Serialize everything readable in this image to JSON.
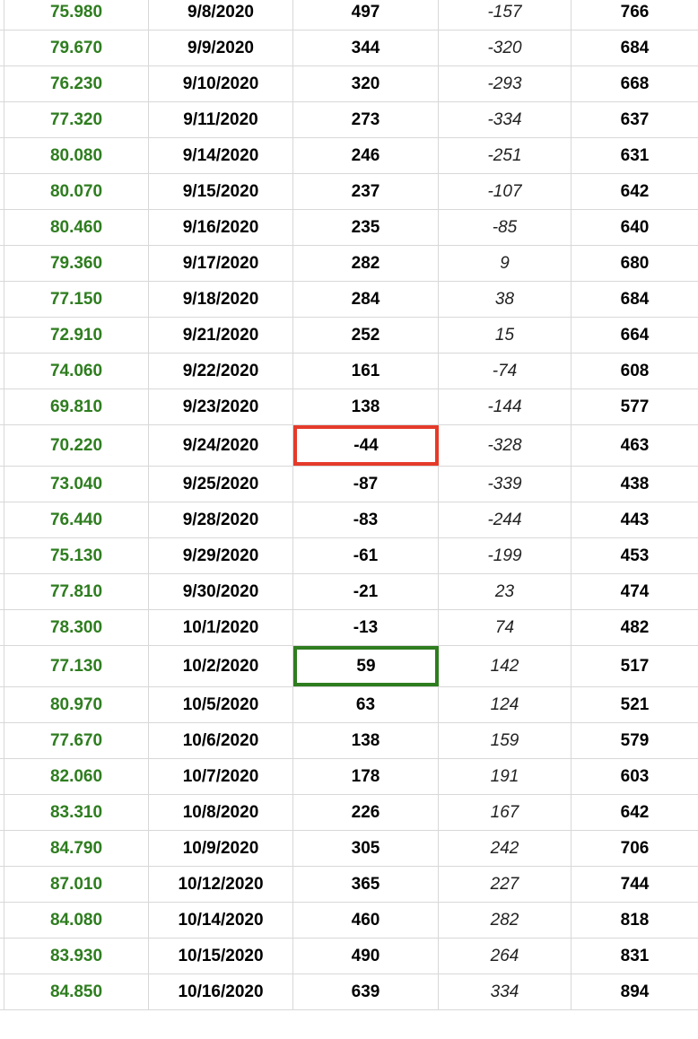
{
  "highlight_colors": {
    "red": "#e53a2a",
    "green": "#2e7d1f"
  },
  "rows": [
    {
      "c0": "75.980",
      "c1": "9/8/2020",
      "c2": "497",
      "c3": "-157",
      "c4": "766"
    },
    {
      "c0": "79.670",
      "c1": "9/9/2020",
      "c2": "344",
      "c3": "-320",
      "c4": "684"
    },
    {
      "c0": "76.230",
      "c1": "9/10/2020",
      "c2": "320",
      "c3": "-293",
      "c4": "668"
    },
    {
      "c0": "77.320",
      "c1": "9/11/2020",
      "c2": "273",
      "c3": "-334",
      "c4": "637"
    },
    {
      "c0": "80.080",
      "c1": "9/14/2020",
      "c2": "246",
      "c3": "-251",
      "c4": "631"
    },
    {
      "c0": "80.070",
      "c1": "9/15/2020",
      "c2": "237",
      "c3": "-107",
      "c4": "642"
    },
    {
      "c0": "80.460",
      "c1": "9/16/2020",
      "c2": "235",
      "c3": "-85",
      "c4": "640"
    },
    {
      "c0": "79.360",
      "c1": "9/17/2020",
      "c2": "282",
      "c3": "9",
      "c4": "680"
    },
    {
      "c0": "77.150",
      "c1": "9/18/2020",
      "c2": "284",
      "c3": "38",
      "c4": "684"
    },
    {
      "c0": "72.910",
      "c1": "9/21/2020",
      "c2": "252",
      "c3": "15",
      "c4": "664"
    },
    {
      "c0": "74.060",
      "c1": "9/22/2020",
      "c2": "161",
      "c3": "-74",
      "c4": "608"
    },
    {
      "c0": "69.810",
      "c1": "9/23/2020",
      "c2": "138",
      "c3": "-144",
      "c4": "577"
    },
    {
      "c0": "70.220",
      "c1": "9/24/2020",
      "c2": "-44",
      "c3": "-328",
      "c4": "463",
      "highlight": "red"
    },
    {
      "c0": "73.040",
      "c1": "9/25/2020",
      "c2": "-87",
      "c3": "-339",
      "c4": "438"
    },
    {
      "c0": "76.440",
      "c1": "9/28/2020",
      "c2": "-83",
      "c3": "-244",
      "c4": "443"
    },
    {
      "c0": "75.130",
      "c1": "9/29/2020",
      "c2": "-61",
      "c3": "-199",
      "c4": "453"
    },
    {
      "c0": "77.810",
      "c1": "9/30/2020",
      "c2": "-21",
      "c3": "23",
      "c4": "474"
    },
    {
      "c0": "78.300",
      "c1": "10/1/2020",
      "c2": "-13",
      "c3": "74",
      "c4": "482"
    },
    {
      "c0": "77.130",
      "c1": "10/2/2020",
      "c2": "59",
      "c3": "142",
      "c4": "517",
      "highlight": "green"
    },
    {
      "c0": "80.970",
      "c1": "10/5/2020",
      "c2": "63",
      "c3": "124",
      "c4": "521"
    },
    {
      "c0": "77.670",
      "c1": "10/6/2020",
      "c2": "138",
      "c3": "159",
      "c4": "579"
    },
    {
      "c0": "82.060",
      "c1": "10/7/2020",
      "c2": "178",
      "c3": "191",
      "c4": "603"
    },
    {
      "c0": "83.310",
      "c1": "10/8/2020",
      "c2": "226",
      "c3": "167",
      "c4": "642"
    },
    {
      "c0": "84.790",
      "c1": "10/9/2020",
      "c2": "305",
      "c3": "242",
      "c4": "706"
    },
    {
      "c0": "87.010",
      "c1": "10/12/2020",
      "c2": "365",
      "c3": "227",
      "c4": "744"
    },
    {
      "c0": "84.080",
      "c1": "10/14/2020",
      "c2": "460",
      "c3": "282",
      "c4": "818"
    },
    {
      "c0": "83.930",
      "c1": "10/15/2020",
      "c2": "490",
      "c3": "264",
      "c4": "831"
    },
    {
      "c0": "84.850",
      "c1": "10/16/2020",
      "c2": "639",
      "c3": "334",
      "c4": "894"
    }
  ]
}
